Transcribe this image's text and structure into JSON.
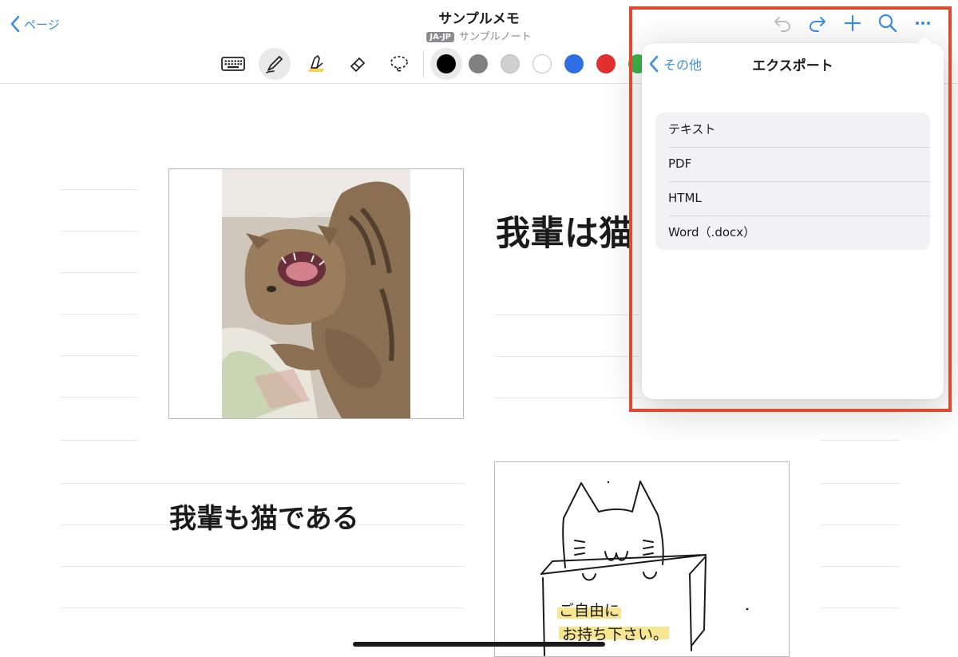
{
  "header": {
    "back_label": "ページ",
    "title": "サンプルメモ",
    "language_badge": "JA-JP",
    "notebook_name": "サンプルノート"
  },
  "toolbar": {
    "tools": [
      "keyboard-icon",
      "pen-icon",
      "highlighter-icon",
      "eraser-icon",
      "lasso-icon"
    ],
    "selected_tool": "pen-icon",
    "colors": [
      "#000000",
      "#808080",
      "#d0d0d0",
      "#ffffff",
      "#2f6fe4",
      "#e03030",
      "#3db34a"
    ],
    "selected_color": "#000000"
  },
  "top_actions": [
    "undo-icon",
    "redo-icon",
    "add-icon",
    "search-icon",
    "more-icon"
  ],
  "canvas": {
    "heading_1": "我輩は猫",
    "heading_2": "我輩も猫である",
    "drawing_text_line1": "ご自由に",
    "drawing_text_line2": "お持ち下さい。"
  },
  "export_popover": {
    "back_label": "その他",
    "title": "エクスポート",
    "options": [
      {
        "label": "テキスト"
      },
      {
        "label": "PDF"
      },
      {
        "label": "HTML"
      },
      {
        "label": "Word（.docx）"
      }
    ]
  },
  "colors": {
    "accent": "#3d8fe0",
    "highlight_frame": "#e2472f"
  }
}
